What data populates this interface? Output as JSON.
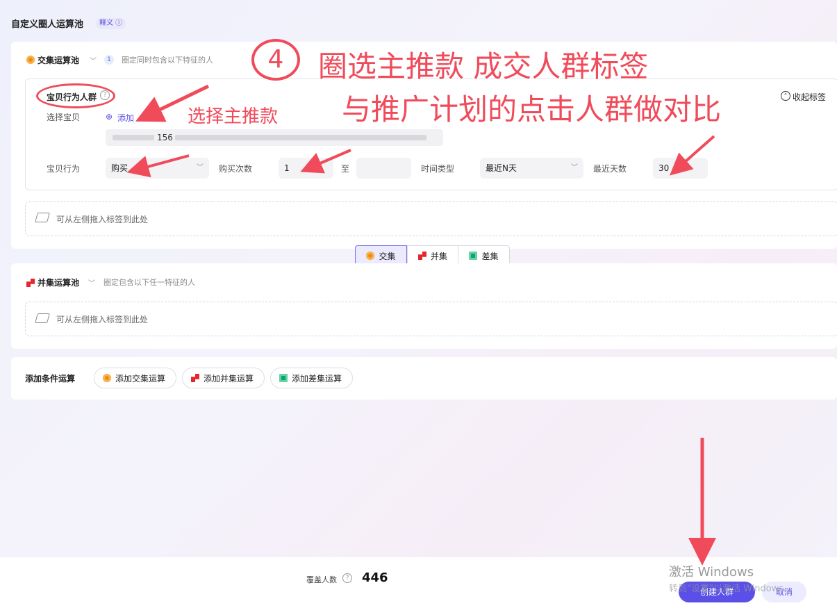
{
  "header": {
    "title": "自定义圈人运算池",
    "help_tag": "释义 ⓘ"
  },
  "intersection_pool": {
    "title": "交集运算池",
    "count": "1",
    "desc": "圈定同时包含以下特征的人",
    "condition": {
      "title": "宝贝行为人群",
      "collapse_label": "收起标签",
      "select_item_label": "选择宝贝",
      "add_label": "添加",
      "item_text": "156",
      "behavior_label": "宝贝行为",
      "behavior_value": "购买",
      "count_label": "购买次数",
      "count_from": "1",
      "to_label": "至",
      "count_to": "",
      "time_type_label": "时间类型",
      "time_type_value": "最近N天",
      "days_label": "最近天数",
      "days_value": "30"
    },
    "drop_text": "可从左侧拖入标签到此处"
  },
  "operator_tabs": [
    {
      "label": "交集",
      "icon": "intersection-icon"
    },
    {
      "label": "并集",
      "icon": "union-icon"
    },
    {
      "label": "差集",
      "icon": "difference-icon"
    }
  ],
  "union_pool": {
    "title": "并集运算池",
    "desc": "圈定包含以下任一特征的人",
    "drop_text": "可从左侧拖入标签到此处"
  },
  "add_conditions": {
    "label": "添加条件运算",
    "buttons": [
      "添加交集运算",
      "添加并集运算",
      "添加差集运算"
    ]
  },
  "footer": {
    "coverage_label": "覆盖人数",
    "coverage_value": "446",
    "create_button": "创建人群",
    "cancel_button": "取消"
  },
  "annotations": {
    "step_number": "4",
    "line1": "圈选主推款 成交人群标签",
    "line2": "与推广计划的点击人群做对比",
    "select_main": "选择主推款"
  },
  "watermark": {
    "line1": "激活 Windows",
    "line2": "转到\"设置\"以激活 Windows。"
  },
  "colors": {
    "accent": "#5a4fe6",
    "annotation": "#f04b5a",
    "intersection": "#f08a13",
    "union": "#e5262e",
    "difference": "#0fa36b"
  }
}
